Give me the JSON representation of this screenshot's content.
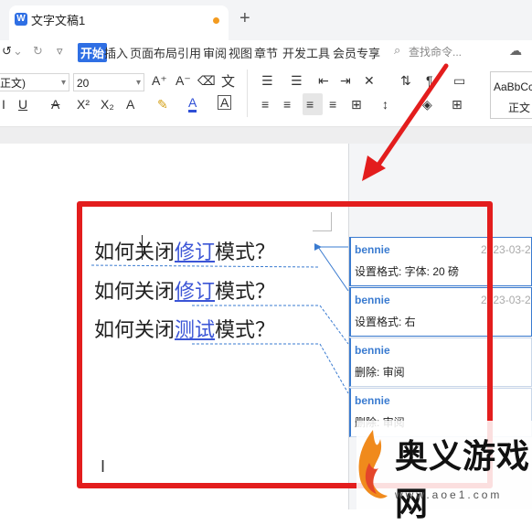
{
  "window": {
    "tab_title": "文字文稿1",
    "new_tab_label": "+"
  },
  "menu": {
    "items": [
      "开始",
      "插入",
      "页面布局",
      "引用",
      "审阅",
      "视图",
      "章节",
      "开发工具",
      "会员专享"
    ],
    "search_placeholder": "查找命令...",
    "undo_glyph": "↺",
    "redo_glyph": "↻"
  },
  "ribbon": {
    "style_value": "正文)",
    "font_size_value": "20",
    "style_gallery_sample": "AaBbCcD",
    "style_gallery_name": "正文",
    "format_glyphs": {
      "grow_font": "A⁺",
      "shrink_font": "A⁻",
      "clear_format": "⌫",
      "phonetic": "文",
      "underline": "U",
      "strike": "A",
      "superscript": "X²",
      "subscript": "X₂",
      "text_effect": "A",
      "highlight": "✎",
      "font_color": "A",
      "char_border": "A"
    }
  },
  "document": {
    "lines": [
      {
        "before": "如何关闭",
        "revised": "修订",
        "after": "模式？"
      },
      {
        "before": "如何关闭",
        "revised": "修订",
        "after": "模式？"
      },
      {
        "before": "如何关闭",
        "revised": "测试",
        "after": "模式？"
      }
    ]
  },
  "comments": [
    {
      "author": "bennie",
      "date": "2023-03-2",
      "text": "设置格式: 字体: 20 磅"
    },
    {
      "author": "bennie",
      "date": "2023-03-2",
      "text": "设置格式: 右"
    },
    {
      "author": "bennie",
      "date": "",
      "text": "删除: 审阅"
    },
    {
      "author": "bennie",
      "date": "",
      "text": "删除: 审阅"
    }
  ],
  "watermark": {
    "title": "奥义游戏网",
    "url": "www.aoe1.com"
  },
  "colors": {
    "accent": "#2f6fe4",
    "annotation_red": "#e31d1d",
    "revision_blue": "#3b55d6",
    "comment_border": "#3a7bd0"
  }
}
